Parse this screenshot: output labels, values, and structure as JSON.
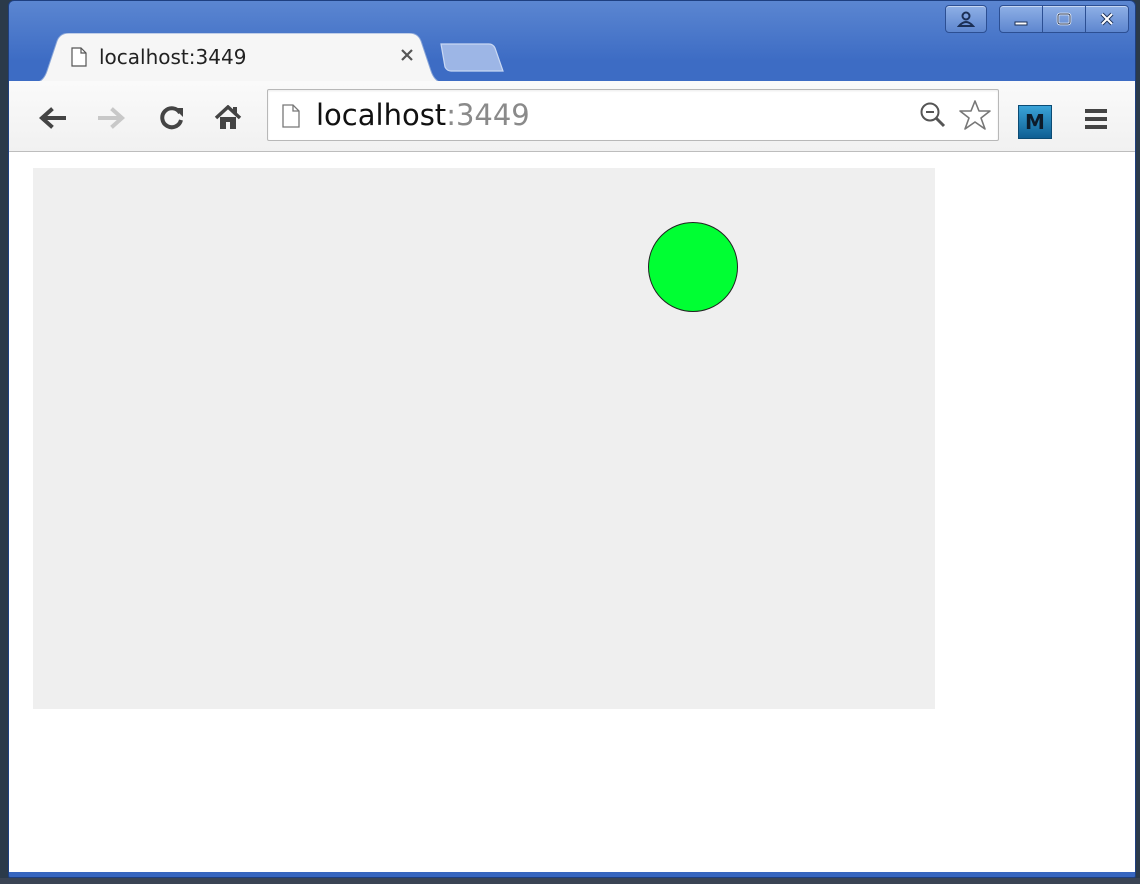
{
  "browser": {
    "tab": {
      "title": "localhost:3449",
      "favicon": "page-icon",
      "close_icon": "close-icon"
    },
    "new_tab_icon": "new-tab-icon",
    "window_controls": [
      "profile-icon",
      "minimize-icon",
      "maximize-icon",
      "close-icon"
    ],
    "toolbar": {
      "back_icon": "back-arrow-icon",
      "forward_icon": "forward-arrow-icon",
      "reload_icon": "reload-icon",
      "home_icon": "home-icon",
      "omnibox": {
        "host": "localhost",
        "port": ":3449",
        "page_icon": "page-icon",
        "zoom_icon": "zoom-out-icon",
        "bookmark_icon": "star-icon"
      },
      "extension": {
        "label": "M",
        "color": "#1f7fb8"
      },
      "menu_icon": "hamburger-menu-icon"
    }
  },
  "page": {
    "canvas_color": "#efefef",
    "ball_color": "#00ff33"
  }
}
